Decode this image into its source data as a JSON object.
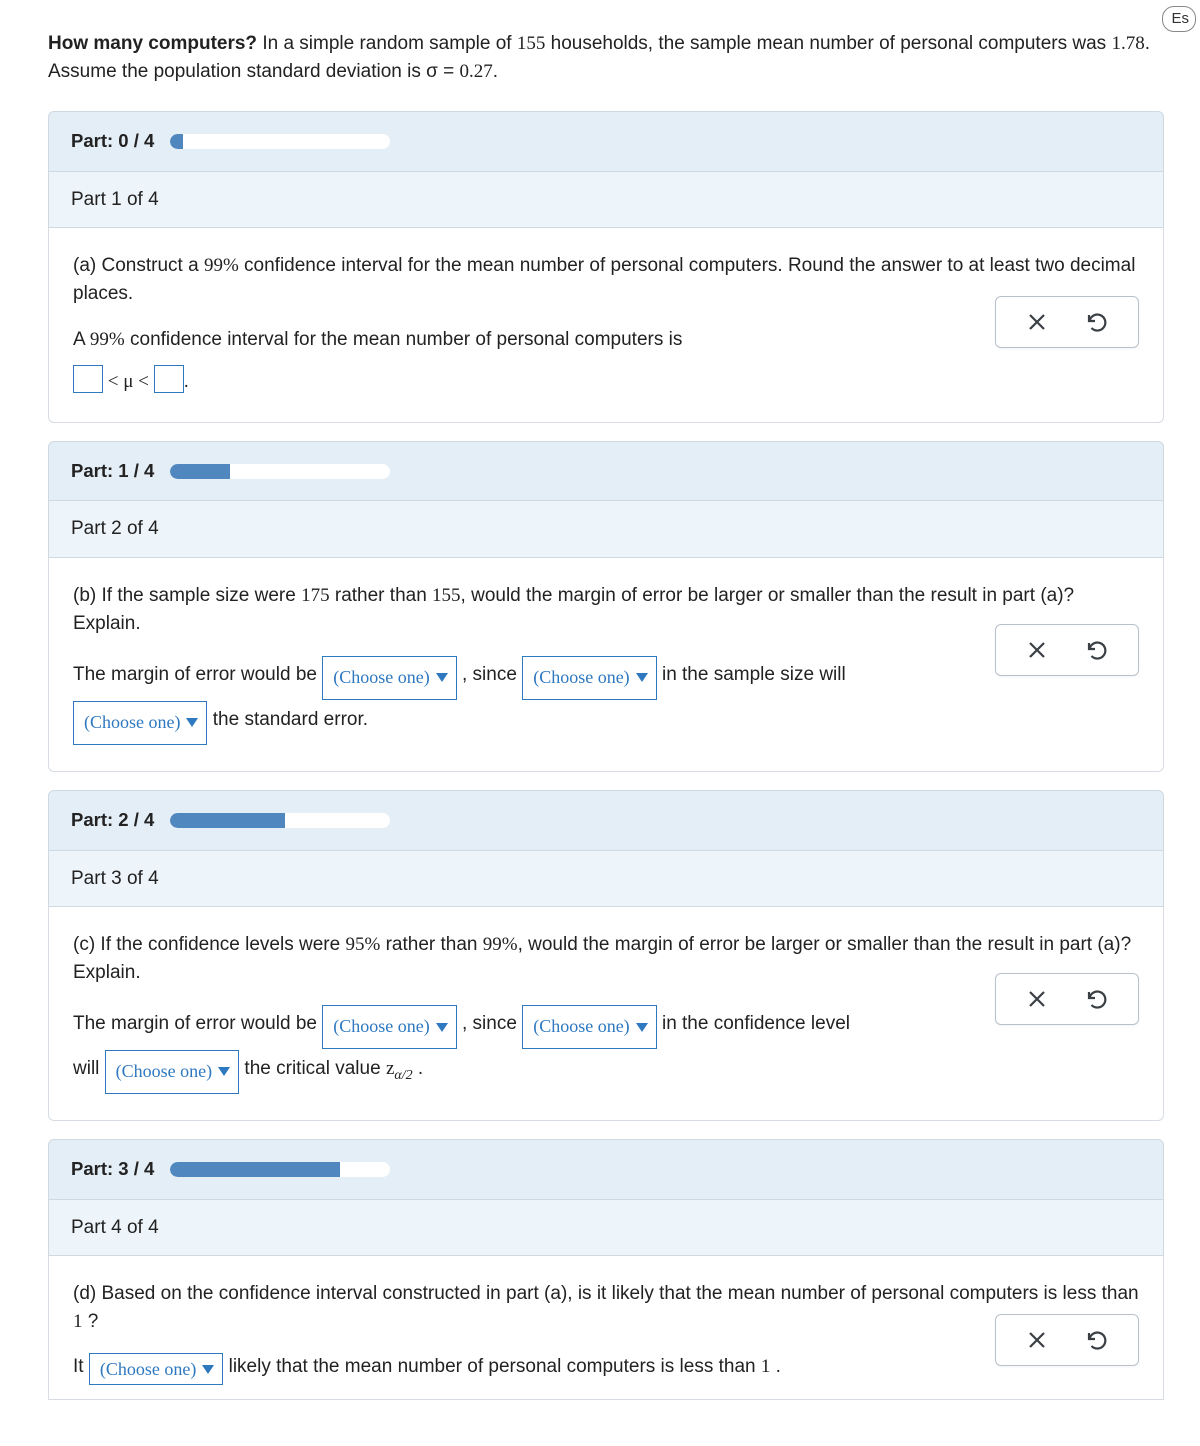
{
  "corner": "Es",
  "intro": {
    "title": "How many computers?",
    "t1": "In a simple random sample of ",
    "n": "155",
    "t2": " households, the sample mean number of personal computers was ",
    "mean": "1.78",
    "t3": ". Assume the population standard deviation is σ = ",
    "sd": "0.27",
    "t4": "."
  },
  "progress": [
    {
      "label": "Part: 0 / 4",
      "pct": 6
    },
    {
      "label": "Part: 1 / 4",
      "pct": 27
    },
    {
      "label": "Part: 2 / 4",
      "pct": 52
    },
    {
      "label": "Part: 3 / 4",
      "pct": 77
    }
  ],
  "parts": {
    "p1": {
      "head": "Part 1 of 4",
      "q1": "(a) Construct a ",
      "pct": "99%",
      "q2": " confidence interval for the mean number of personal computers. Round the answer to at least two decimal places.",
      "a1": "A ",
      "a2": " confidence interval for the mean number of personal computers is",
      "lt1": " < μ < ",
      "dot": "."
    },
    "p2": {
      "head": "Part 2 of 4",
      "q1": "(b) If the sample size were ",
      "n1": "175",
      "q2": " rather than ",
      "n2": "155",
      "q3": ", would the margin of error be larger or smaller than the result in part (a)? Explain.",
      "s1": "The margin of error would be ",
      "s2": " , since ",
      "s3": " in the sample size will ",
      "s4": " the standard error."
    },
    "p3": {
      "head": "Part 3 of 4",
      "q1": "(c) If the confidence levels were ",
      "p1": "95%",
      "q2": " rather than ",
      "p2": "99%",
      "q3": ", would the margin of error be larger or smaller than the result in part (a)? Explain.",
      "s1": "The margin of error would be ",
      "s2": " , since ",
      "s3": " in the confidence level will ",
      "s4": " the critical value ",
      "zv": "z",
      "zs": "α/2",
      "s5": " ."
    },
    "p4": {
      "head": "Part 4 of 4",
      "q1": "(d) Based on the confidence interval constructed in part (a), is it likely that the mean number of personal computers is less than ",
      "one": "1",
      "q2": " ?",
      "s1": "It ",
      "s2": " likely that the mean number of personal computers is less than ",
      "s3": " ."
    }
  },
  "choose": "(Choose one)"
}
